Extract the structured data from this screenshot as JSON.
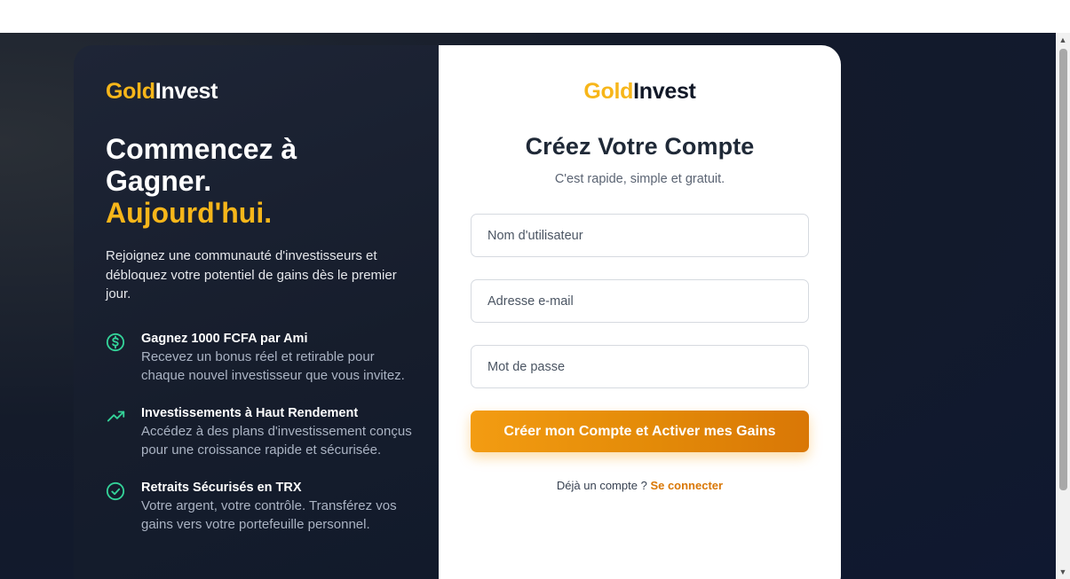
{
  "brand": {
    "gold": "Gold",
    "invest": "Invest"
  },
  "hero": {
    "headline_line1": "Commencez à",
    "headline_line2": "Gagner.",
    "headline_accent": "Aujourd'hui.",
    "intro": "Rejoignez une communauté d'investisseurs et débloquez votre potentiel de gains dès le premier jour."
  },
  "features": [
    {
      "icon": "dollar-circle-icon",
      "title": "Gagnez 1000 FCFA par Ami",
      "desc": "Recevez un bonus réel et retirable pour chaque nouvel investisseur que vous invitez."
    },
    {
      "icon": "trending-up-icon",
      "title": "Investissements à Haut Rendement",
      "desc": "Accédez à des plans d'investissement conçus pour une croissance rapide et sécurisée."
    },
    {
      "icon": "check-circle-icon",
      "title": "Retraits Sécurisés en TRX",
      "desc": "Votre argent, votre contrôle. Transférez vos gains vers votre portefeuille personnel."
    }
  ],
  "form": {
    "title": "Créez Votre Compte",
    "subtitle": "C'est rapide, simple et gratuit.",
    "username_placeholder": "Nom d'utilisateur",
    "email_placeholder": "Adresse e-mail",
    "password_placeholder": "Mot de passe",
    "submit_label": "Créer mon Compte et Activer mes Gains",
    "login_prompt": "Déjà un compte ?",
    "login_link": "Se connecter"
  },
  "colors": {
    "accent_gold": "#f7b61a",
    "button_orange": "#f39c12",
    "feature_icon_green": "#34d399",
    "dark_panel": "#1e2536"
  }
}
